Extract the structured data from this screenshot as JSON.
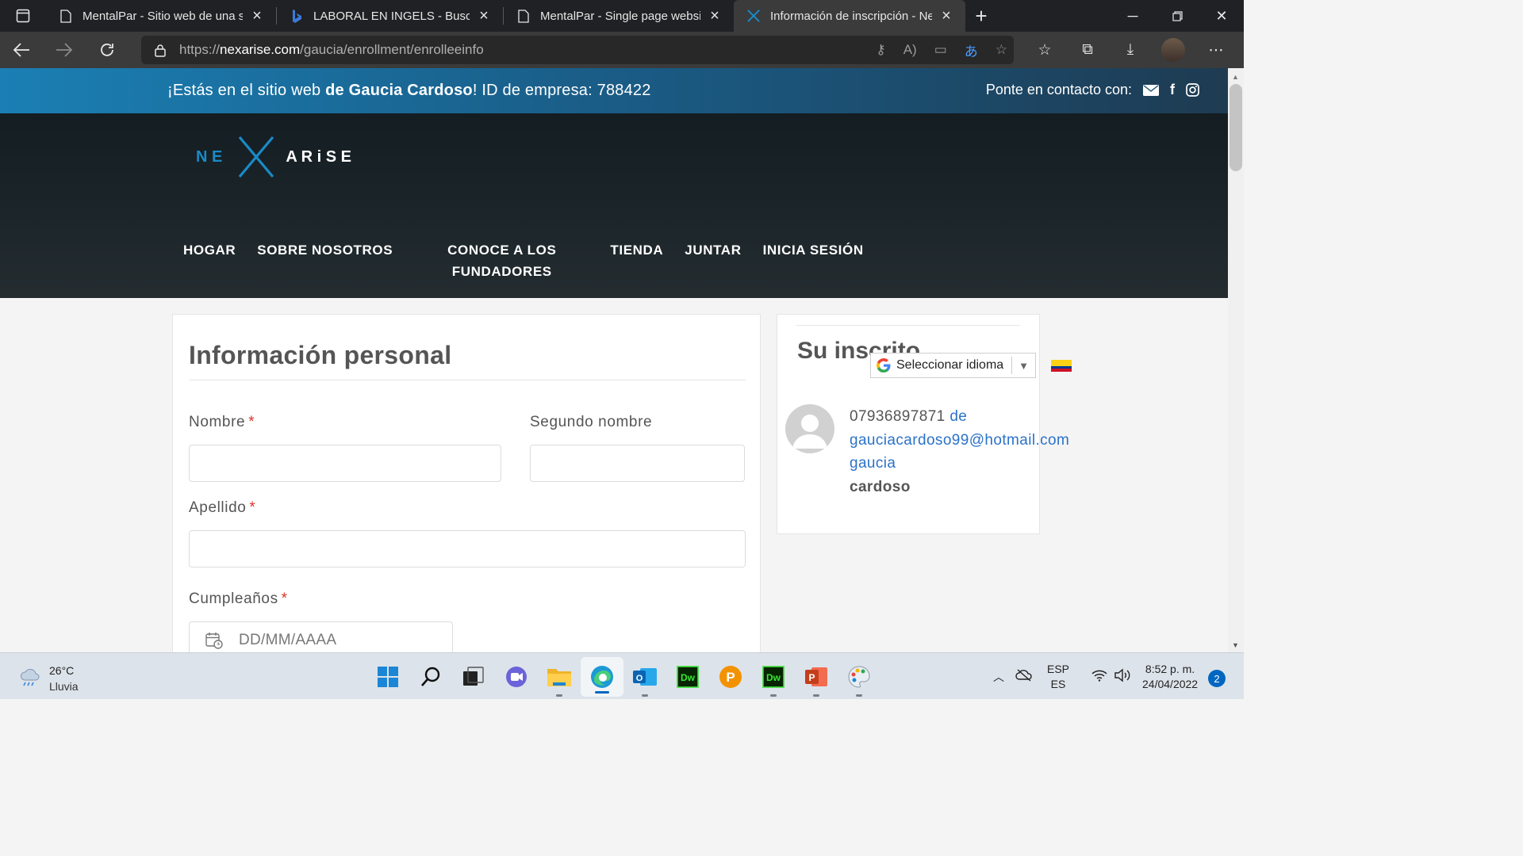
{
  "browser": {
    "tabs": [
      {
        "title": "MentalPar - Sitio web de una sol",
        "icon": "page-icon"
      },
      {
        "title": "LABORAL EN INGELS - Buscar",
        "icon": "bing-icon"
      },
      {
        "title": "MentalPar - Single page website",
        "icon": "page-icon"
      },
      {
        "title": "Información de inscripción - NeX",
        "icon": "nexarise-icon",
        "active": true
      }
    ],
    "url_prefix": "https://",
    "url_domain": "nexarise.com",
    "url_path": "/gaucia/enrollment/enrolleeinfo"
  },
  "topbar": {
    "msg_start": "¡Estás en el sitio web ",
    "msg_bold": "de Gaucia Cardoso",
    "msg_end": "! ID de empresa: 788422",
    "contact_label": "Ponte en contacto con:"
  },
  "logo": {
    "ne": "N E",
    "arise": "A R i S E"
  },
  "nav": {
    "home": "HOGAR",
    "about": "SOBRE NOSOTROS",
    "founders_line1": "CONOCE A LOS",
    "founders_line2": "FUNDADORES",
    "store": "TIENDA",
    "join": "JUNTAR",
    "login": "INICIA SESIÓN"
  },
  "form": {
    "title": "Información personal",
    "first_name_label": "Nombre",
    "middle_name_label": "Segundo nombre",
    "last_name_label": "Apellido",
    "birthday_label": "Cumpleaños",
    "required_mark": "*",
    "first_name_value": "",
    "middle_name_value": "",
    "last_name_value": "",
    "birthday_placeholder": "DD/MM/AAAA"
  },
  "sidebar": {
    "title": "Su inscrito",
    "language_select": "Seleccionar idioma",
    "phone": "07936897871",
    "de": "de",
    "email": "gauciacardoso99@hotmail.com",
    "first_name": "gaucia",
    "last_name": "cardoso"
  },
  "taskbar": {
    "temperature": "26°C",
    "weather": "Lluvia",
    "lang_top": "ESP",
    "lang_bottom": "ES",
    "time": "8:52 p. m.",
    "date": "24/04/2022",
    "notifications": "2"
  },
  "colors": {
    "brand_blue": "#1a8ac8",
    "link_blue": "#2b72c9",
    "required_red": "#d9342b",
    "header_dark": "#1b2529"
  }
}
